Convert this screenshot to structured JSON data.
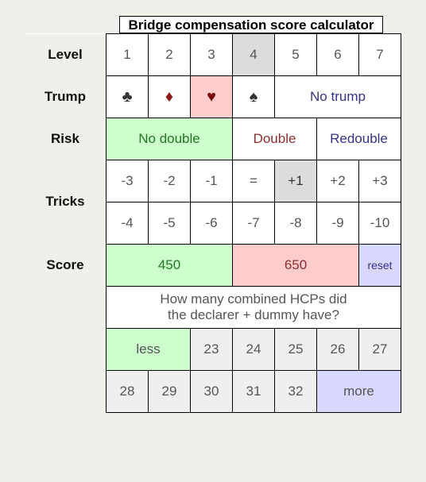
{
  "title": "Bridge compensation score calculator",
  "labels": {
    "level": "Level",
    "trump": "Trump",
    "risk": "Risk",
    "tricks": "Tricks",
    "score": "Score"
  },
  "levels": [
    "1",
    "2",
    "3",
    "4",
    "5",
    "6",
    "7"
  ],
  "trumps": {
    "clubs": "♣",
    "diamonds": "♦",
    "hearts": "♥",
    "spades": "♠",
    "no_trump": "No trump"
  },
  "risk": {
    "no_double": "No double",
    "double": "Double",
    "redouble": "Redouble"
  },
  "tricks_row1": [
    "-3",
    "-2",
    "-1",
    "=",
    "+1",
    "+2",
    "+3"
  ],
  "tricks_row2": [
    "-4",
    "-5",
    "-6",
    "-7",
    "-8",
    "-9",
    "-10"
  ],
  "score": {
    "made": "450",
    "doubled": "650",
    "reset": "reset"
  },
  "question": {
    "line1": "How many combined HCPs did",
    "line2": "the declarer + dummy have?"
  },
  "hcp_row1": {
    "less": "less",
    "values": [
      "23",
      "24",
      "25",
      "26",
      "27"
    ]
  },
  "hcp_row2": {
    "values": [
      "28",
      "29",
      "30",
      "31",
      "32"
    ],
    "more": "more"
  },
  "selected": {
    "level": "4",
    "trump": "hearts",
    "risk": "No double",
    "tricks": "+1"
  },
  "colors": {
    "selected_gray": "#dcdcdc",
    "green": "#ccffcc",
    "pink": "#ffcccc",
    "blue": "#d8d8ff"
  }
}
